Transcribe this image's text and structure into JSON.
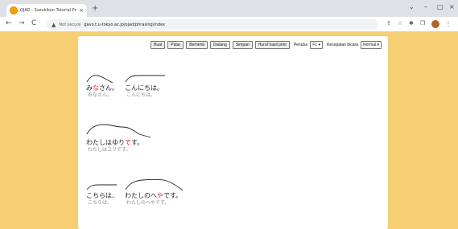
{
  "browser": {
    "tab_title": "OJAD - Suzukikun Tutorial Pro",
    "tab_close": "×",
    "new_tab": "+",
    "window": {
      "minimize": "⌄",
      "restore": "–",
      "maximize": "□",
      "close": "×"
    },
    "nav": {
      "back": "←",
      "forward": "→",
      "reload": "C"
    },
    "not_secure": "Not secure",
    "url": "gavo.t.u-tokyo.ac.jp/ojad/phrasing/index",
    "ext_icons": [
      "⇪",
      "☆",
      "✱",
      "❐"
    ]
  },
  "toolbar": {
    "buttons": [
      "Buat",
      "Putar",
      "Berhenti",
      "Diulang",
      "Simpan",
      "Huruf hasil print"
    ],
    "voice_label": "Penutur",
    "voice_value": "F1 ▾",
    "speed_label": "Kecepatan bicara",
    "speed_value": "Normal ▾"
  },
  "phrases": [
    {
      "pre": "み",
      "hl": "な",
      "post": "さん。",
      "reading": "みなさん。"
    },
    {
      "pre": "こんにちは。",
      "hl": "",
      "post": "",
      "reading": "こんにちは。"
    },
    {
      "pre": "わたしはゆり",
      "hl": "で",
      "post": "す。",
      "reading": "わたしはユリです。"
    },
    {
      "pre": "こちらは、",
      "hl": "",
      "post": "",
      "reading": "こちらは、"
    },
    {
      "pre": "わたしのへ",
      "hl": "や",
      "post": "です。",
      "reading": "わたしのへやです。"
    }
  ]
}
